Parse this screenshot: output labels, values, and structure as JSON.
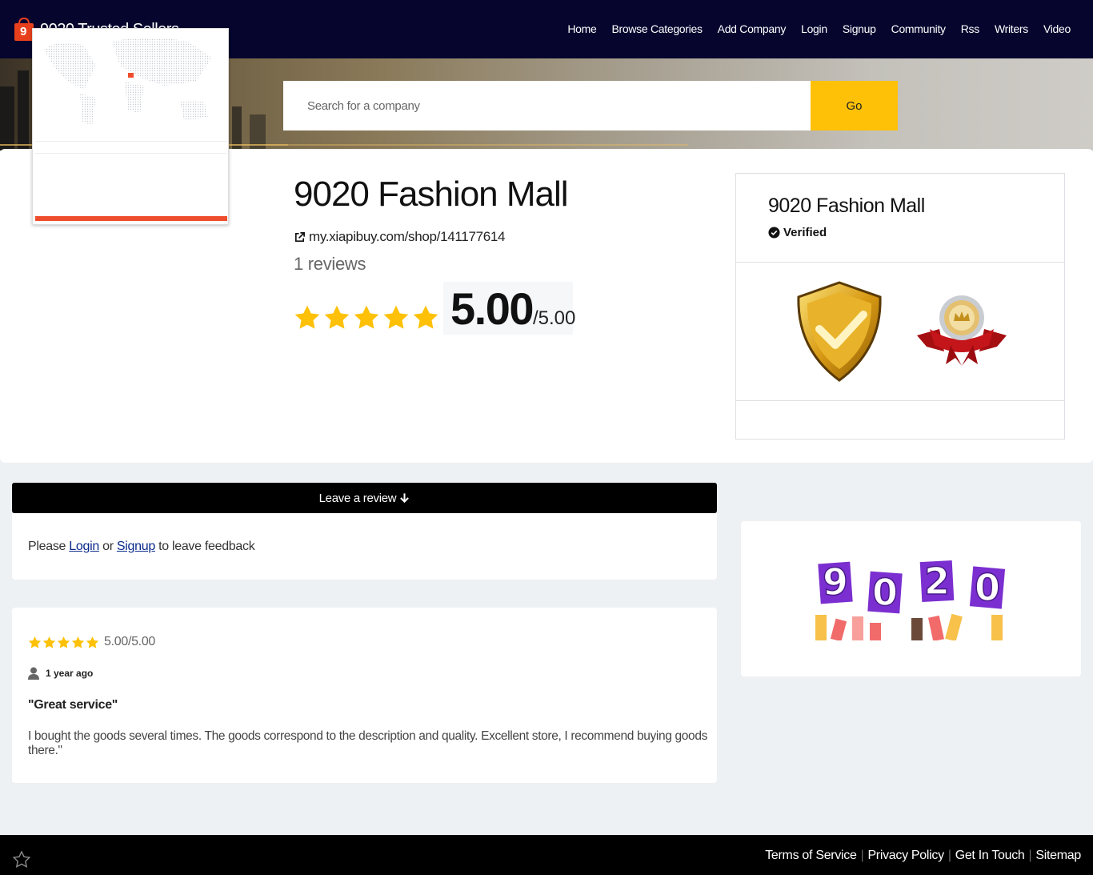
{
  "brand": {
    "logo_digit": "9",
    "name": "9020 Trusted Sellers"
  },
  "nav": [
    "Home",
    "Browse Categories",
    "Add Company",
    "Login",
    "Signup",
    "Community",
    "Rss",
    "Writers",
    "Video"
  ],
  "search": {
    "placeholder": "Search for a company",
    "button": "Go"
  },
  "company": {
    "name": "9020 Fashion Mall",
    "url": "my.xiapibuy.com/shop/141177614",
    "reviews": "1 reviews",
    "score": "5.00",
    "score_out_of": "/5.00",
    "stars": 5
  },
  "side": {
    "name": "9020 Fashion Mall",
    "verified": "Verified"
  },
  "leave_review": {
    "label": "Leave a review"
  },
  "login_prompt": {
    "prefix": "Please",
    "login": "Login",
    "or": "or",
    "signup": "Signup",
    "suffix": "to leave feedback"
  },
  "review": {
    "stars": 5,
    "score": "5.00/5.00",
    "time": "1 year ago",
    "title": "\"Great service\"",
    "text": "I bought the goods several times. The goods correspond to the description and quality. Excellent store, I recommend buying goods there.\""
  },
  "promo": {
    "digits": [
      "9",
      "0",
      "2",
      "0"
    ]
  },
  "footer": {
    "links": [
      "Terms of Service",
      "Privacy Policy",
      "Get In Touch",
      "Sitemap"
    ]
  },
  "colors": {
    "navbar": "#05052e",
    "accent": "#fec107",
    "star": "#fec107",
    "promo_card": "#7b2fd0"
  }
}
